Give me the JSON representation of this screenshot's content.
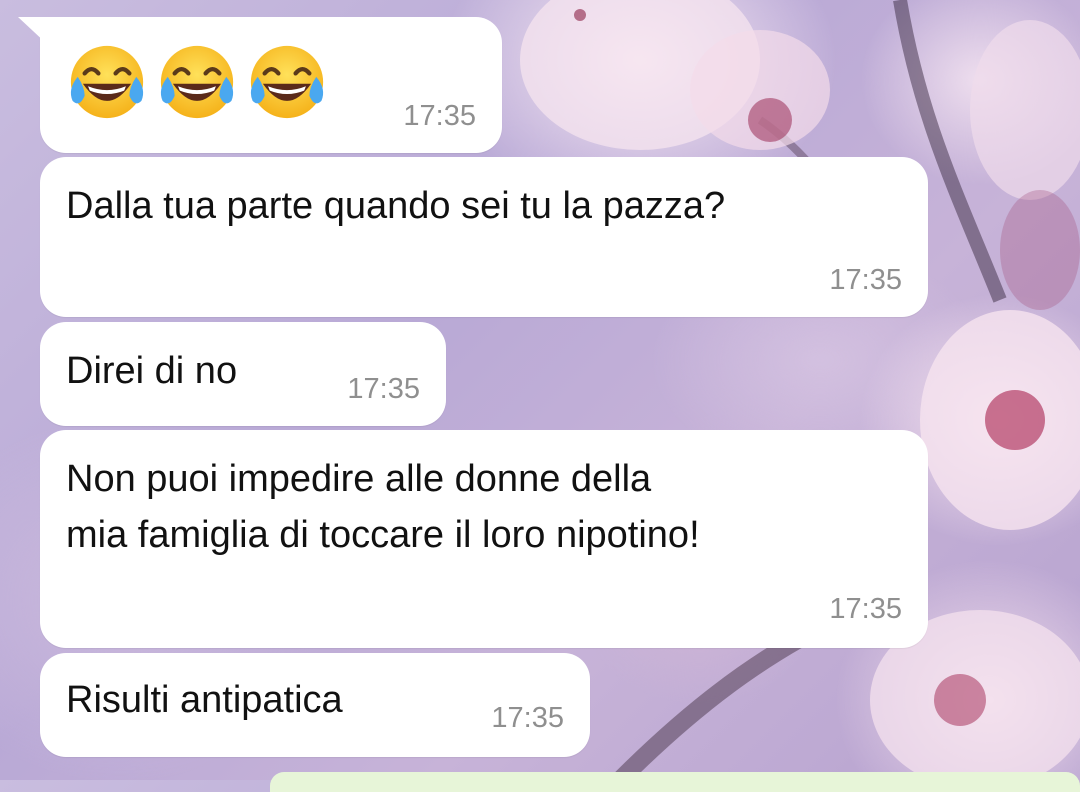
{
  "chat": {
    "messages": [
      {
        "type": "emoji",
        "emoji": [
          "face-with-tears-of-joy-icon",
          "face-with-tears-of-joy-icon",
          "face-with-tears-of-joy-icon"
        ],
        "time": "17:35"
      },
      {
        "type": "text",
        "text": "Dalla tua parte quando sei tu la pazza?",
        "time": "17:35"
      },
      {
        "type": "text",
        "text": "Direi di no",
        "time": "17:35"
      },
      {
        "type": "text",
        "lines": [
          "Non puoi impedire alle donne della",
          "mia famiglia di toccare il loro nipotino!"
        ],
        "time": "17:35"
      },
      {
        "type": "text",
        "text": "Risulti antipatica",
        "time": "17:35"
      }
    ]
  },
  "colors": {
    "bubble_incoming": "#ffffff",
    "bubble_outgoing": "#e7f5d8",
    "timestamp": "#8f8f8f",
    "text": "#111111"
  }
}
